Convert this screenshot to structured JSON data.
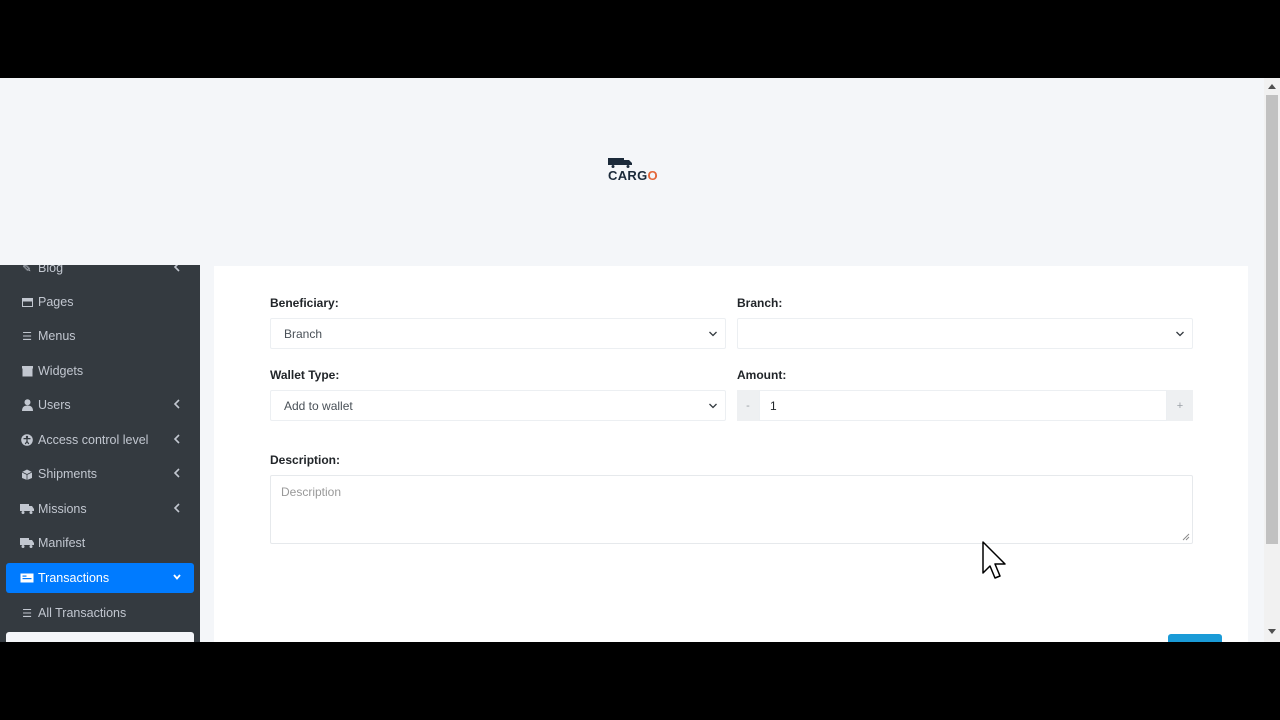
{
  "brand": {
    "logo_text_prefix": "CAR",
    "logo_text_g": "G",
    "logo_text_o": "O"
  },
  "sidebar": {
    "items": [
      {
        "label": "Blog",
        "icon": "blog-icon",
        "has_chevron": true
      },
      {
        "label": "Pages",
        "icon": "pages-icon",
        "has_chevron": false
      },
      {
        "label": "Menus",
        "icon": "list-icon",
        "has_chevron": false
      },
      {
        "label": "Widgets",
        "icon": "widgets-icon",
        "has_chevron": false
      },
      {
        "label": "Users",
        "icon": "user-icon",
        "has_chevron": true
      },
      {
        "label": "Access control level",
        "icon": "universal-access-icon",
        "has_chevron": true
      },
      {
        "label": "Shipments",
        "icon": "box-icon",
        "has_chevron": true
      },
      {
        "label": "Missions",
        "icon": "truck-icon",
        "has_chevron": true
      },
      {
        "label": "Manifest",
        "icon": "truck-icon",
        "has_chevron": false
      },
      {
        "label": "Transactions",
        "icon": "money-icon",
        "has_chevron": true,
        "active": true
      },
      {
        "label": "All Transactions",
        "icon": "list-icon",
        "has_chevron": false
      }
    ]
  },
  "form": {
    "beneficiary": {
      "label": "Beneficiary:",
      "value": "Branch"
    },
    "branch": {
      "label": "Branch:",
      "value": ""
    },
    "wallet_type": {
      "label": "Wallet Type:",
      "value": "Add to wallet"
    },
    "amount": {
      "label": "Amount:",
      "value": "1",
      "minus": "-",
      "plus": "+"
    },
    "description": {
      "label": "Description:",
      "placeholder": "Description"
    }
  },
  "colors": {
    "accent": "#007bff",
    "sidebar_bg": "#343a40",
    "page_bg": "#f4f6f9",
    "submit": "#1a9bd7"
  }
}
